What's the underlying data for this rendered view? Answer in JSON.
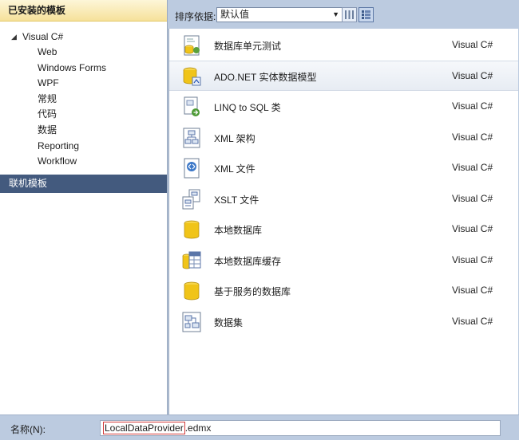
{
  "left_pane": {
    "header": "已安装的模板",
    "tree_root": "Visual C#",
    "tree_items": [
      "Web",
      "Windows Forms",
      "WPF",
      "常规",
      "代码",
      "数据",
      "Reporting",
      "Workflow"
    ],
    "online_templates": "联机模板"
  },
  "toolbar": {
    "sort_label": "排序依据:",
    "sort_value": "默认值"
  },
  "templates": [
    {
      "name": "数据库单元测试",
      "lang": "Visual C#",
      "icon": "database-unit-test-icon"
    },
    {
      "name": "ADO.NET 实体数据模型",
      "lang": "Visual C#",
      "icon": "entity-data-model-icon"
    },
    {
      "name": "LINQ to SQL 类",
      "lang": "Visual C#",
      "icon": "linq-to-sql-icon"
    },
    {
      "name": "XML 架构",
      "lang": "Visual C#",
      "icon": "xml-schema-icon"
    },
    {
      "name": "XML 文件",
      "lang": "Visual C#",
      "icon": "xml-file-icon"
    },
    {
      "name": "XSLT 文件",
      "lang": "Visual C#",
      "icon": "xslt-file-icon"
    },
    {
      "name": "本地数据库",
      "lang": "Visual C#",
      "icon": "local-database-icon"
    },
    {
      "name": "本地数据库缓存",
      "lang": "Visual C#",
      "icon": "local-database-cache-icon"
    },
    {
      "name": "基于服务的数据库",
      "lang": "Visual C#",
      "icon": "service-database-icon"
    },
    {
      "name": "数据集",
      "lang": "Visual C#",
      "icon": "dataset-icon"
    }
  ],
  "selected_index": 1,
  "bottom": {
    "name_label": "名称(N):",
    "name_highlighted": "LocalDataProvider",
    "name_suffix": ".edmx"
  },
  "colors": {
    "chrome": "#bccbe0",
    "online_templates_bg": "#435a7e",
    "header_gold": "#f6e19a",
    "highlight_border": "#d33a3a",
    "db_cylinder": "#f0c419"
  }
}
